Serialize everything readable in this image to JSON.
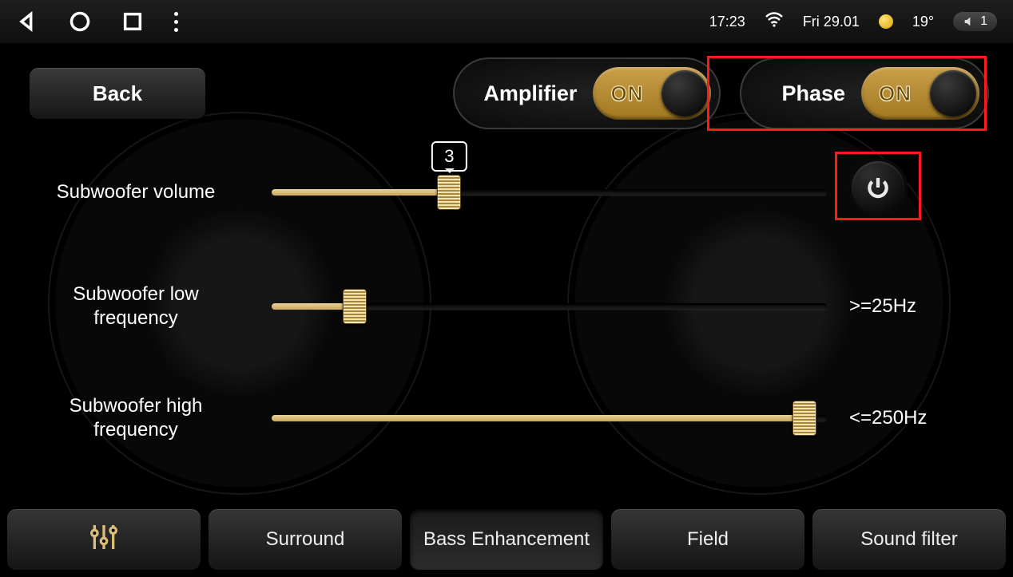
{
  "statusbar": {
    "time": "17:23",
    "date": "Fri 29.01",
    "temp": "19°",
    "volume_badge": "1"
  },
  "back_label": "Back",
  "toggles": {
    "amplifier": {
      "label": "Amplifier",
      "state": "ON"
    },
    "phase": {
      "label": "Phase",
      "state": "ON"
    }
  },
  "sliders": {
    "sub_volume": {
      "label": "Subwoofer volume",
      "tooltip": "3",
      "fill_pct": 32,
      "thumb_pct": 32
    },
    "sub_low": {
      "label": "Subwoofer low frequency",
      "value": ">=25Hz",
      "fill_pct": 15,
      "thumb_pct": 15
    },
    "sub_high": {
      "label": "Subwoofer high frequency",
      "value": "<=250Hz",
      "fill_pct": 96,
      "thumb_pct": 96
    }
  },
  "tabs": {
    "eq_icon": "equalizer",
    "surround": "Surround",
    "bass": "Bass Enhancement",
    "field": "Field",
    "filter": "Sound filter"
  }
}
